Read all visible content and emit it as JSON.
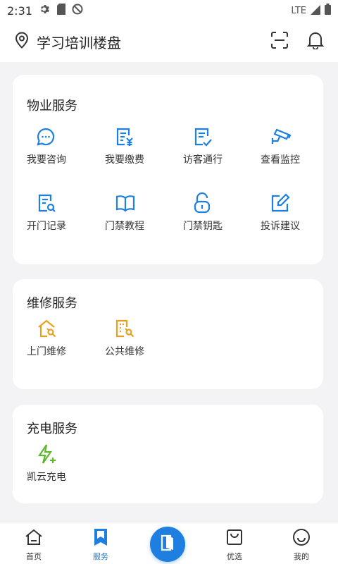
{
  "status": {
    "time": "2:31",
    "network": "LTE"
  },
  "header": {
    "title": "学习培训楼盘"
  },
  "property_section": {
    "title": "物业服务",
    "items": [
      {
        "label": "我要咨询",
        "icon": "chat-bubble-icon"
      },
      {
        "label": "我要缴费",
        "icon": "bill-payment-icon"
      },
      {
        "label": "访客通行",
        "icon": "visitor-pass-icon"
      },
      {
        "label": "查看监控",
        "icon": "cctv-camera-icon"
      },
      {
        "label": "开门记录",
        "icon": "door-record-icon"
      },
      {
        "label": "门禁教程",
        "icon": "open-book-icon"
      },
      {
        "label": "门禁钥匙",
        "icon": "unlock-padlock-icon"
      },
      {
        "label": "投诉建议",
        "icon": "edit-note-icon"
      }
    ]
  },
  "repair_section": {
    "title": "维修服务",
    "items": [
      {
        "label": "上门维修",
        "icon": "home-repair-icon"
      },
      {
        "label": "公共维修",
        "icon": "building-repair-icon"
      }
    ]
  },
  "charging_section": {
    "title": "充电服务",
    "items": [
      {
        "label": "凯云充电",
        "icon": "lightning-charge-icon"
      }
    ]
  },
  "tabs": [
    {
      "label": "首页",
      "icon": "home-icon",
      "active": false
    },
    {
      "label": "服务",
      "icon": "bookmark-icon",
      "active": true
    },
    {
      "label": "优选",
      "icon": "shopping-bag-icon",
      "active": false
    },
    {
      "label": "我的",
      "icon": "smile-face-icon",
      "active": false
    }
  ],
  "colors": {
    "accent": "#1e7fe0",
    "repair": "#e8a021",
    "charge": "#5cb82a"
  }
}
